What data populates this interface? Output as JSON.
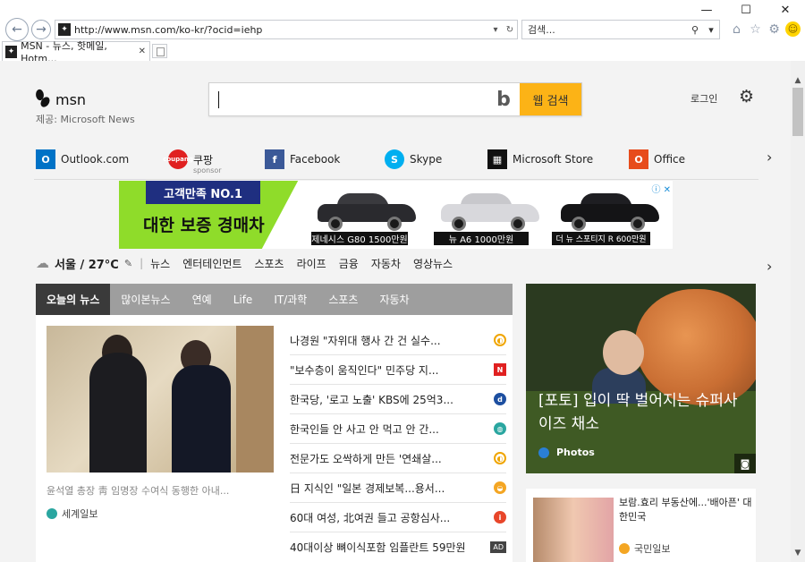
{
  "browser": {
    "window_controls": {
      "minimize": "—",
      "maximize": "☐",
      "close": "✕"
    },
    "url": "http://www.msn.com/ko-kr/?ocid=iehp",
    "search_placeholder": "검색...",
    "tab_title": "MSN - 뉴스, 핫메일, Hotm...",
    "icons": [
      "home-icon",
      "star-icon",
      "gear-icon",
      "smiley-icon"
    ]
  },
  "header": {
    "logo_text": "msn",
    "provided_by": "제공: Microsoft News",
    "search_button": "웹 검색",
    "login": "로그인"
  },
  "quick_links": [
    {
      "label": "Outlook.com",
      "icon": "outlook-icon",
      "color": "#0072c6"
    },
    {
      "label": "쿠팡",
      "sub": "sponsor",
      "icon": "coupang-icon",
      "color": "#e02020"
    },
    {
      "label": "Facebook",
      "icon": "facebook-icon",
      "color": "#3b5998"
    },
    {
      "label": "Skype",
      "icon": "skype-icon",
      "color": "#00aff0"
    },
    {
      "label": "Microsoft Store",
      "icon": "store-icon",
      "color": "#111111"
    },
    {
      "label": "Office",
      "icon": "office-icon",
      "color": "#e74c1c"
    }
  ],
  "ad": {
    "badge": "고객만족 NO.1",
    "headline": "대한 보증 경매차",
    "cars": [
      "제네시스 G80 1500만원",
      "뉴 A6 1000만원",
      "더 뉴 스포티지 R 600만원"
    ]
  },
  "weather": {
    "location_temp": "서울 / 27°C"
  },
  "categories": [
    "뉴스",
    "엔터테인먼트",
    "스포츠",
    "라이프",
    "금융",
    "자동차",
    "영상뉴스"
  ],
  "news": {
    "tabs": [
      "오늘의 뉴스",
      "많이본뉴스",
      "연예",
      "Life",
      "IT/과학",
      "스포츠",
      "자동차"
    ],
    "main_caption": "윤석열 총장 靑 임명장 수여식 동행한 아내...",
    "main_source": "세계일보",
    "headlines": [
      {
        "title": "나경원 \"자위대 행사 간 건 실수...",
        "src_color": "#f0a500",
        "src": "◐"
      },
      {
        "title": "\"보수층이 움직인다\" 민주당 지...",
        "src_color": "#e02020",
        "src": "N"
      },
      {
        "title": "한국당, '로고 노출' KBS에 25억3...",
        "src_color": "#1d4fa0",
        "src": "d"
      },
      {
        "title": "한국인들 안 사고 안 먹고 안 간...",
        "src_color": "#2aa6a0",
        "src": "◍"
      },
      {
        "title": "전문가도 오싹하게 만든 '연쇄살...",
        "src_color": "#f0a500",
        "src": "◐"
      },
      {
        "title": "日 지식인 \"일본 경제보복...용서...",
        "src_color": "#f4a623",
        "src": "◒"
      },
      {
        "title": "60대 여성, 北여권 들고 공항심사...",
        "src_color": "#e8462a",
        "src": "i"
      },
      {
        "title": "40대이상 뼈이식포함 임플란트 59만원",
        "ad": "AD"
      }
    ]
  },
  "featured": {
    "title": "[포토] 입이 딱 벌어지는 슈퍼사이즈 채소",
    "source": "Photos"
  },
  "story2": {
    "title": "보람.효리 부동산에...'배아픈' 대한민국",
    "source": "국민일보"
  }
}
